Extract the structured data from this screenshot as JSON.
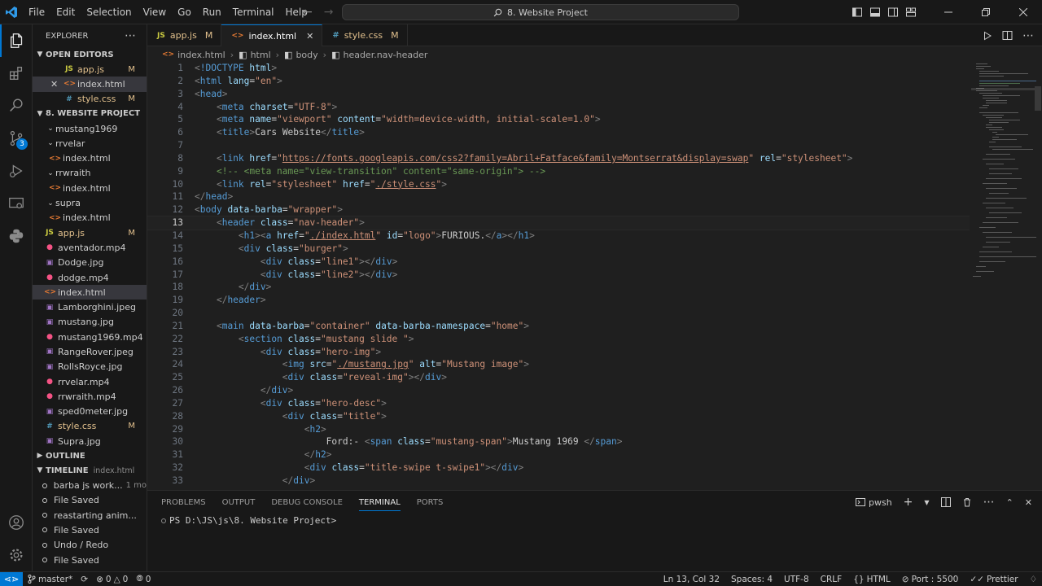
{
  "titlebar": {
    "menu": [
      "File",
      "Edit",
      "Selection",
      "View",
      "Go",
      "Run",
      "Terminal",
      "Help"
    ],
    "search_text": "8. Website Project"
  },
  "activitybar": {
    "scm_badge": "3"
  },
  "explorer": {
    "title": "EXPLORER",
    "open_editors_label": "OPEN EDITORS",
    "open_editors": [
      {
        "name": "app.js",
        "kind": "js",
        "badge": "M"
      },
      {
        "name": "index.html",
        "kind": "html",
        "badge": ""
      },
      {
        "name": "style.css",
        "kind": "css",
        "badge": "M"
      }
    ],
    "project_label": "8. WEBSITE PROJECT",
    "files": [
      {
        "name": "mustang1969",
        "type": "folder",
        "depth": 1
      },
      {
        "name": "rrvelar",
        "type": "folder",
        "depth": 1
      },
      {
        "name": "index.html",
        "type": "html",
        "depth": 2
      },
      {
        "name": "rrwraith",
        "type": "folder",
        "depth": 1
      },
      {
        "name": "index.html",
        "type": "html",
        "depth": 2
      },
      {
        "name": "supra",
        "type": "folder",
        "depth": 1
      },
      {
        "name": "index.html",
        "type": "html",
        "depth": 2
      },
      {
        "name": "app.js",
        "type": "js",
        "depth": 1,
        "badge": "M"
      },
      {
        "name": "aventador.mp4",
        "type": "mp4",
        "depth": 1
      },
      {
        "name": "Dodge.jpg",
        "type": "img",
        "depth": 1
      },
      {
        "name": "dodge.mp4",
        "type": "mp4",
        "depth": 1
      },
      {
        "name": "index.html",
        "type": "html",
        "depth": 1,
        "selected": true
      },
      {
        "name": "Lamborghini.jpeg",
        "type": "img",
        "depth": 1
      },
      {
        "name": "mustang.jpg",
        "type": "img",
        "depth": 1
      },
      {
        "name": "mustang1969.mp4",
        "type": "mp4",
        "depth": 1
      },
      {
        "name": "RangeRover.jpeg",
        "type": "img",
        "depth": 1
      },
      {
        "name": "RollsRoyce.jpg",
        "type": "img",
        "depth": 1
      },
      {
        "name": "rrvelar.mp4",
        "type": "mp4",
        "depth": 1
      },
      {
        "name": "rrwraith.mp4",
        "type": "mp4",
        "depth": 1
      },
      {
        "name": "sped0meter.jpg",
        "type": "img",
        "depth": 1
      },
      {
        "name": "style.css",
        "type": "css",
        "depth": 1,
        "badge": "M"
      },
      {
        "name": "Supra.jpg",
        "type": "img",
        "depth": 1
      }
    ],
    "outline_label": "OUTLINE",
    "timeline_label": "TIMELINE",
    "timeline_file": "index.html",
    "timeline": [
      {
        "label": "barba js work...",
        "time": "1 mo"
      },
      {
        "label": "File Saved",
        "time": ""
      },
      {
        "label": "reastarting anim...",
        "time": ""
      },
      {
        "label": "File Saved",
        "time": ""
      },
      {
        "label": "Undo / Redo",
        "time": ""
      },
      {
        "label": "File Saved",
        "time": ""
      },
      {
        "label": "File Saved",
        "time": ""
      }
    ]
  },
  "tabs": [
    {
      "label": "app.js",
      "kind": "js",
      "badge": "M",
      "active": false
    },
    {
      "label": "index.html",
      "kind": "html",
      "badge": "",
      "active": true
    },
    {
      "label": "style.css",
      "kind": "css",
      "badge": "M",
      "active": false
    }
  ],
  "breadcrumb": [
    "index.html",
    "html",
    "body",
    "header.nav-header"
  ],
  "editor": {
    "current_line": 13,
    "lines": [
      [
        [
          "pt",
          "<"
        ],
        [
          "tg",
          "!DOCTYPE"
        ],
        [
          "tx",
          " "
        ],
        [
          "at",
          "html"
        ],
        [
          "pt",
          ">"
        ]
      ],
      [
        [
          "pt",
          "<"
        ],
        [
          "tg",
          "html"
        ],
        [
          "tx",
          " "
        ],
        [
          "at",
          "lang"
        ],
        [
          "tx",
          "="
        ],
        [
          "st",
          "\"en\""
        ],
        [
          "pt",
          ">"
        ]
      ],
      [
        [
          "pt",
          "<"
        ],
        [
          "tg",
          "head"
        ],
        [
          "pt",
          ">"
        ]
      ],
      [
        [
          "tx",
          "    "
        ],
        [
          "pt",
          "<"
        ],
        [
          "tg",
          "meta"
        ],
        [
          "tx",
          " "
        ],
        [
          "at",
          "charset"
        ],
        [
          "tx",
          "="
        ],
        [
          "st",
          "\"UTF-8\""
        ],
        [
          "pt",
          ">"
        ]
      ],
      [
        [
          "tx",
          "    "
        ],
        [
          "pt",
          "<"
        ],
        [
          "tg",
          "meta"
        ],
        [
          "tx",
          " "
        ],
        [
          "at",
          "name"
        ],
        [
          "tx",
          "="
        ],
        [
          "st",
          "\"viewport\""
        ],
        [
          "tx",
          " "
        ],
        [
          "at",
          "content"
        ],
        [
          "tx",
          "="
        ],
        [
          "st",
          "\"width=device-width, initial-scale=1.0\""
        ],
        [
          "pt",
          ">"
        ]
      ],
      [
        [
          "tx",
          "    "
        ],
        [
          "pt",
          "<"
        ],
        [
          "tg",
          "title"
        ],
        [
          "pt",
          ">"
        ],
        [
          "tx",
          "Cars Website"
        ],
        [
          "pt",
          "</"
        ],
        [
          "tg",
          "title"
        ],
        [
          "pt",
          ">"
        ]
      ],
      [],
      [
        [
          "tx",
          "    "
        ],
        [
          "pt",
          "<"
        ],
        [
          "tg",
          "link"
        ],
        [
          "tx",
          " "
        ],
        [
          "at",
          "href"
        ],
        [
          "tx",
          "="
        ],
        [
          "st",
          "\""
        ],
        [
          "stu",
          "https://fonts.googleapis.com/css2?family=Abril+Fatface&family=Montserrat&display=swap"
        ],
        [
          "st",
          "\""
        ],
        [
          "tx",
          " "
        ],
        [
          "at",
          "rel"
        ],
        [
          "tx",
          "="
        ],
        [
          "st",
          "\"stylesheet\""
        ],
        [
          "pt",
          ">"
        ]
      ],
      [
        [
          "tx",
          "    "
        ],
        [
          "cm",
          "<!-- <meta name=\"view-transition\" content=\"same-origin\"> -->"
        ]
      ],
      [
        [
          "tx",
          "    "
        ],
        [
          "pt",
          "<"
        ],
        [
          "tg",
          "link"
        ],
        [
          "tx",
          " "
        ],
        [
          "at",
          "rel"
        ],
        [
          "tx",
          "="
        ],
        [
          "st",
          "\"stylesheet\""
        ],
        [
          "tx",
          " "
        ],
        [
          "at",
          "href"
        ],
        [
          "tx",
          "="
        ],
        [
          "st",
          "\""
        ],
        [
          "stu",
          "./style.css"
        ],
        [
          "st",
          "\""
        ],
        [
          "pt",
          ">"
        ]
      ],
      [
        [
          "pt",
          "</"
        ],
        [
          "tg",
          "head"
        ],
        [
          "pt",
          ">"
        ]
      ],
      [
        [
          "pt",
          "<"
        ],
        [
          "tg",
          "body"
        ],
        [
          "tx",
          " "
        ],
        [
          "at",
          "data-barba"
        ],
        [
          "tx",
          "="
        ],
        [
          "st",
          "\"wrapper\""
        ],
        [
          "pt",
          ">"
        ]
      ],
      [
        [
          "tx",
          "    "
        ],
        [
          "pt",
          "<"
        ],
        [
          "tg",
          "header"
        ],
        [
          "tx",
          " "
        ],
        [
          "at",
          "class"
        ],
        [
          "tx",
          "="
        ],
        [
          "st",
          "\"nav-header\""
        ],
        [
          "pt",
          ">"
        ]
      ],
      [
        [
          "tx",
          "        "
        ],
        [
          "pt",
          "<"
        ],
        [
          "tg",
          "h1"
        ],
        [
          "pt",
          "><"
        ],
        [
          "tg",
          "a"
        ],
        [
          "tx",
          " "
        ],
        [
          "at",
          "href"
        ],
        [
          "tx",
          "="
        ],
        [
          "st",
          "\""
        ],
        [
          "stu",
          "./index.html"
        ],
        [
          "st",
          "\""
        ],
        [
          "tx",
          " "
        ],
        [
          "at",
          "id"
        ],
        [
          "tx",
          "="
        ],
        [
          "st",
          "\"logo\""
        ],
        [
          "pt",
          ">"
        ],
        [
          "tx",
          "FURIOUS."
        ],
        [
          "pt",
          "</"
        ],
        [
          "tg",
          "a"
        ],
        [
          "pt",
          "></"
        ],
        [
          "tg",
          "h1"
        ],
        [
          "pt",
          ">"
        ]
      ],
      [
        [
          "tx",
          "        "
        ],
        [
          "pt",
          "<"
        ],
        [
          "tg",
          "div"
        ],
        [
          "tx",
          " "
        ],
        [
          "at",
          "class"
        ],
        [
          "tx",
          "="
        ],
        [
          "st",
          "\"burger\""
        ],
        [
          "pt",
          ">"
        ]
      ],
      [
        [
          "tx",
          "            "
        ],
        [
          "pt",
          "<"
        ],
        [
          "tg",
          "div"
        ],
        [
          "tx",
          " "
        ],
        [
          "at",
          "class"
        ],
        [
          "tx",
          "="
        ],
        [
          "st",
          "\"line1\""
        ],
        [
          "pt",
          "></"
        ],
        [
          "tg",
          "div"
        ],
        [
          "pt",
          ">"
        ]
      ],
      [
        [
          "tx",
          "            "
        ],
        [
          "pt",
          "<"
        ],
        [
          "tg",
          "div"
        ],
        [
          "tx",
          " "
        ],
        [
          "at",
          "class"
        ],
        [
          "tx",
          "="
        ],
        [
          "st",
          "\"line2\""
        ],
        [
          "pt",
          "></"
        ],
        [
          "tg",
          "div"
        ],
        [
          "pt",
          ">"
        ]
      ],
      [
        [
          "tx",
          "        "
        ],
        [
          "pt",
          "</"
        ],
        [
          "tg",
          "div"
        ],
        [
          "pt",
          ">"
        ]
      ],
      [
        [
          "tx",
          "    "
        ],
        [
          "pt",
          "</"
        ],
        [
          "tg",
          "header"
        ],
        [
          "pt",
          ">"
        ]
      ],
      [],
      [
        [
          "tx",
          "    "
        ],
        [
          "pt",
          "<"
        ],
        [
          "tg",
          "main"
        ],
        [
          "tx",
          " "
        ],
        [
          "at",
          "data-barba"
        ],
        [
          "tx",
          "="
        ],
        [
          "st",
          "\"container\""
        ],
        [
          "tx",
          " "
        ],
        [
          "at",
          "data-barba-namespace"
        ],
        [
          "tx",
          "="
        ],
        [
          "st",
          "\"home\""
        ],
        [
          "pt",
          ">"
        ]
      ],
      [
        [
          "tx",
          "        "
        ],
        [
          "pt",
          "<"
        ],
        [
          "tg",
          "section"
        ],
        [
          "tx",
          " "
        ],
        [
          "at",
          "class"
        ],
        [
          "tx",
          "="
        ],
        [
          "st",
          "\"mustang slide \""
        ],
        [
          "pt",
          ">"
        ]
      ],
      [
        [
          "tx",
          "            "
        ],
        [
          "pt",
          "<"
        ],
        [
          "tg",
          "div"
        ],
        [
          "tx",
          " "
        ],
        [
          "at",
          "class"
        ],
        [
          "tx",
          "="
        ],
        [
          "st",
          "\"hero-img\""
        ],
        [
          "pt",
          ">"
        ]
      ],
      [
        [
          "tx",
          "                "
        ],
        [
          "pt",
          "<"
        ],
        [
          "tg",
          "img"
        ],
        [
          "tx",
          " "
        ],
        [
          "at",
          "src"
        ],
        [
          "tx",
          "="
        ],
        [
          "st",
          "\""
        ],
        [
          "stu",
          "./mustang.jpg"
        ],
        [
          "st",
          "\""
        ],
        [
          "tx",
          " "
        ],
        [
          "at",
          "alt"
        ],
        [
          "tx",
          "="
        ],
        [
          "st",
          "\"Mustang image\""
        ],
        [
          "pt",
          ">"
        ]
      ],
      [
        [
          "tx",
          "                "
        ],
        [
          "pt",
          "<"
        ],
        [
          "tg",
          "div"
        ],
        [
          "tx",
          " "
        ],
        [
          "at",
          "class"
        ],
        [
          "tx",
          "="
        ],
        [
          "st",
          "\"reveal-img\""
        ],
        [
          "pt",
          "></"
        ],
        [
          "tg",
          "div"
        ],
        [
          "pt",
          ">"
        ]
      ],
      [
        [
          "tx",
          "            "
        ],
        [
          "pt",
          "</"
        ],
        [
          "tg",
          "div"
        ],
        [
          "pt",
          ">"
        ]
      ],
      [
        [
          "tx",
          "            "
        ],
        [
          "pt",
          "<"
        ],
        [
          "tg",
          "div"
        ],
        [
          "tx",
          " "
        ],
        [
          "at",
          "class"
        ],
        [
          "tx",
          "="
        ],
        [
          "st",
          "\"hero-desc\""
        ],
        [
          "pt",
          ">"
        ]
      ],
      [
        [
          "tx",
          "                "
        ],
        [
          "pt",
          "<"
        ],
        [
          "tg",
          "div"
        ],
        [
          "tx",
          " "
        ],
        [
          "at",
          "class"
        ],
        [
          "tx",
          "="
        ],
        [
          "st",
          "\"title\""
        ],
        [
          "pt",
          ">"
        ]
      ],
      [
        [
          "tx",
          "                    "
        ],
        [
          "pt",
          "<"
        ],
        [
          "tg",
          "h2"
        ],
        [
          "pt",
          ">"
        ]
      ],
      [
        [
          "tx",
          "                        Ford:- "
        ],
        [
          "pt",
          "<"
        ],
        [
          "tg",
          "span"
        ],
        [
          "tx",
          " "
        ],
        [
          "at",
          "class"
        ],
        [
          "tx",
          "="
        ],
        [
          "st",
          "\"mustang-span\""
        ],
        [
          "pt",
          ">"
        ],
        [
          "tx",
          "Mustang 1969 "
        ],
        [
          "pt",
          "</"
        ],
        [
          "tg",
          "span"
        ],
        [
          "pt",
          ">"
        ]
      ],
      [
        [
          "tx",
          "                    "
        ],
        [
          "pt",
          "</"
        ],
        [
          "tg",
          "h2"
        ],
        [
          "pt",
          ">"
        ]
      ],
      [
        [
          "tx",
          "                    "
        ],
        [
          "pt",
          "<"
        ],
        [
          "tg",
          "div"
        ],
        [
          "tx",
          " "
        ],
        [
          "at",
          "class"
        ],
        [
          "tx",
          "="
        ],
        [
          "st",
          "\"title-swipe t-swipe1\""
        ],
        [
          "pt",
          "></"
        ],
        [
          "tg",
          "div"
        ],
        [
          "pt",
          ">"
        ]
      ],
      [
        [
          "tx",
          "                "
        ],
        [
          "pt",
          "</"
        ],
        [
          "tg",
          "div"
        ],
        [
          "pt",
          ">"
        ]
      ]
    ]
  },
  "panel": {
    "tabs": [
      "PROBLEMS",
      "OUTPUT",
      "DEBUG CONSOLE",
      "TERMINAL",
      "PORTS"
    ],
    "active_tab": "TERMINAL",
    "shell": "pwsh",
    "prompt": "PS D:\\JS\\js\\8. Website Project>"
  },
  "statusbar": {
    "branch": "master*",
    "errors": "0",
    "warnings": "0",
    "ports": "0",
    "position": "Ln 13, Col 32",
    "spaces": "Spaces: 4",
    "encoding": "UTF-8",
    "eol": "CRLF",
    "language": "HTML",
    "port": "Port : 5500",
    "formatter": "Prettier"
  },
  "colors": {
    "accent": "#0078d4",
    "modified": "#e2c08d",
    "editor_bg": "#1f1f1f",
    "chrome_bg": "#181818"
  }
}
